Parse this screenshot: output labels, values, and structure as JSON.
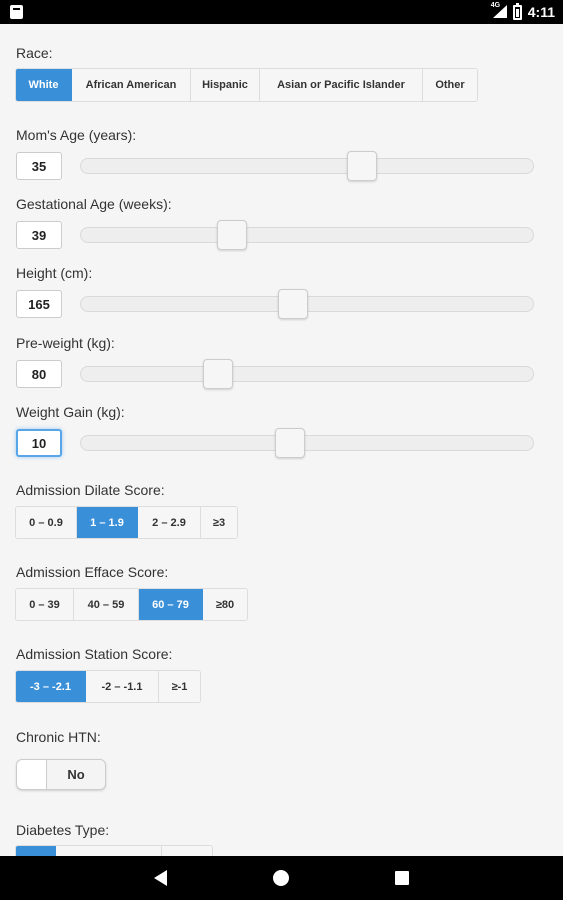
{
  "status_bar": {
    "time": "4:11",
    "network": "4G"
  },
  "form": {
    "race": {
      "label": "Race:",
      "options": [
        "White",
        "African American",
        "Hispanic",
        "Asian or Pacific Islander",
        "Other"
      ],
      "selected": "White"
    },
    "moms_age": {
      "label": "Mom's Age (years):",
      "value": "35",
      "slider_fraction": 0.62
    },
    "gestational_age": {
      "label": "Gestational Age (weeks):",
      "value": "39",
      "slider_fraction": 0.33
    },
    "height": {
      "label": "Height (cm):",
      "value": "165",
      "slider_fraction": 0.47
    },
    "pre_weight": {
      "label": "Pre-weight (kg):",
      "value": "80",
      "slider_fraction": 0.3
    },
    "weight_gain": {
      "label": "Weight Gain (kg):",
      "value": "10",
      "slider_fraction": 0.47
    },
    "dilate": {
      "label": "Admission Dilate Score:",
      "options": [
        "0 – 0.9",
        "1 – 1.9",
        "2 – 2.9",
        "≥3"
      ],
      "selected": "1 – 1.9"
    },
    "efface": {
      "label": "Admission Efface Score:",
      "options": [
        "0 – 39",
        "40 – 59",
        "60 – 79",
        "≥80"
      ],
      "selected": "60 – 79"
    },
    "station": {
      "label": "Admission Station Score:",
      "options": [
        "-3 – -2.1",
        "-2 – -1.1",
        "≥-1"
      ],
      "selected": "-3 – -2.1"
    },
    "chronic_htn": {
      "label": "Chronic HTN:",
      "value": "No"
    },
    "diabetes": {
      "label": "Diabetes Type:"
    }
  },
  "icons": {
    "back": "back-triangle-icon",
    "home": "home-circle-icon",
    "recent": "recent-square-icon"
  },
  "colors": {
    "accent": "#3a8fd9",
    "status_bar": "#000000",
    "background": "#f5f5f5"
  }
}
